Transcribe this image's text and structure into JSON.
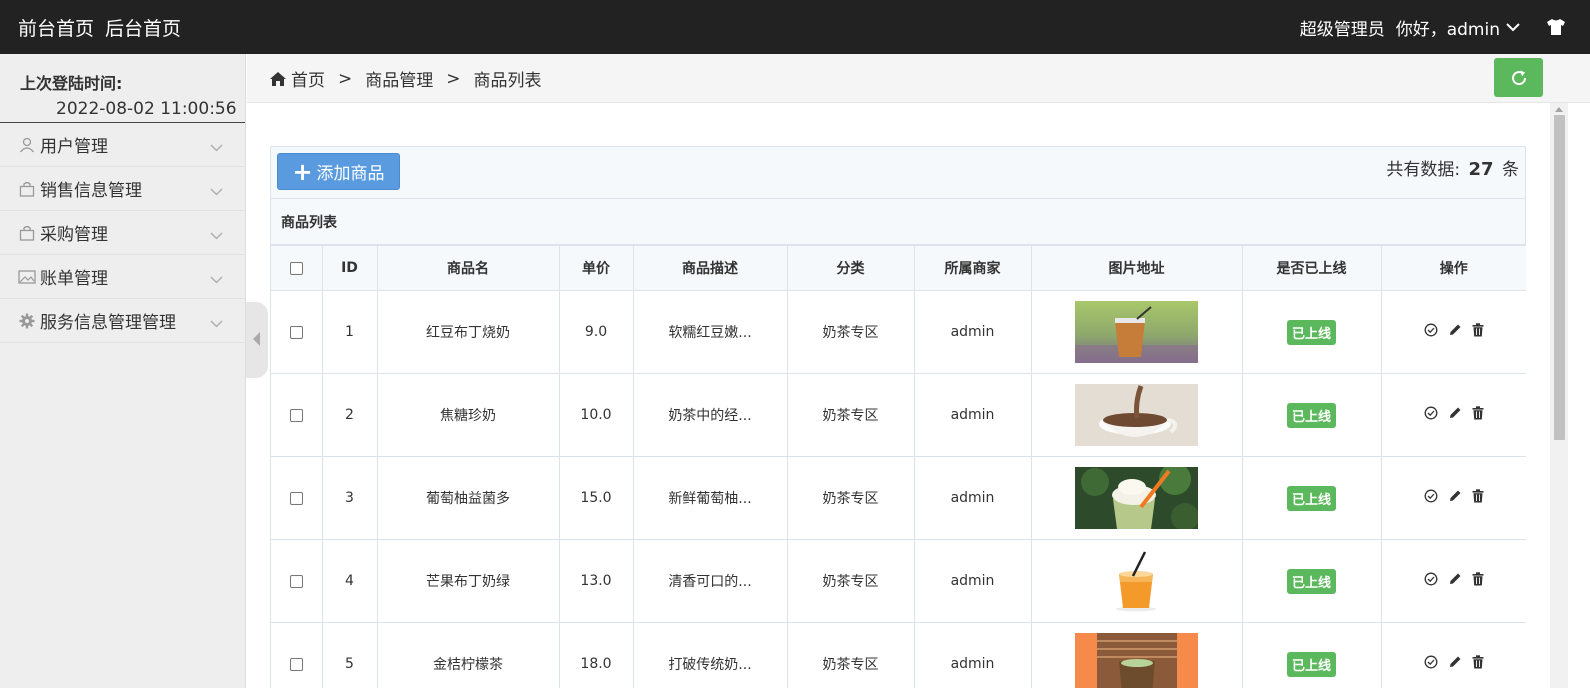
{
  "topbar": {
    "nav": [
      "前台首页",
      "后台首页"
    ],
    "role": "超级管理员",
    "greeting": "你好，admin"
  },
  "sidebar": {
    "login_title": "上次登陆时间:",
    "login_time": "2022-08-02 11:00:56",
    "items": [
      {
        "label": "用户管理",
        "icon": "user-icon"
      },
      {
        "label": "销售信息管理",
        "icon": "bag-icon"
      },
      {
        "label": "采购管理",
        "icon": "bag-icon"
      },
      {
        "label": "账单管理",
        "icon": "image-icon"
      },
      {
        "label": "服务信息管理管理",
        "icon": "gear-icon"
      }
    ]
  },
  "breadcrumb": {
    "home": "首页",
    "sep": ">",
    "level1": "商品管理",
    "level2": "商品列表"
  },
  "panel": {
    "add_label": "添加商品",
    "count_prefix": "共有数据:",
    "count_value": "27",
    "count_suffix": "条",
    "list_title": "商品列表"
  },
  "table": {
    "headers": [
      "ID",
      "商品名",
      "单价",
      "商品描述",
      "分类",
      "所属商家",
      "图片地址",
      "是否已上线",
      "操作"
    ],
    "rows": [
      {
        "id": "1",
        "name": "红豆布丁烧奶",
        "price": "9.0",
        "desc": "软糯红豆嫩...",
        "category": "奶茶专区",
        "merchant": "admin",
        "status": "已上线",
        "image": "iced-milk-tea"
      },
      {
        "id": "2",
        "name": "焦糖珍奶",
        "price": "10.0",
        "desc": "奶茶中的经...",
        "category": "奶茶专区",
        "merchant": "admin",
        "status": "已上线",
        "image": "chocolate-cup"
      },
      {
        "id": "3",
        "name": "葡萄柚益菌多",
        "price": "15.0",
        "desc": "新鲜葡萄柚...",
        "category": "奶茶专区",
        "merchant": "admin",
        "status": "已上线",
        "image": "matcha-cream"
      },
      {
        "id": "4",
        "name": "芒果布丁奶绿",
        "price": "13.0",
        "desc": "清香可口的...",
        "category": "奶茶专区",
        "merchant": "admin",
        "status": "已上线",
        "image": "orange-drink"
      },
      {
        "id": "5",
        "name": "金桔柠檬茶",
        "price": "18.0",
        "desc": "打破传统奶...",
        "category": "奶茶专区",
        "merchant": "admin",
        "status": "已上线",
        "image": "kumquat-tea"
      }
    ]
  },
  "colors": {
    "topbar": "#222222",
    "primary": "#5a9bdf",
    "success": "#5cb85c"
  }
}
